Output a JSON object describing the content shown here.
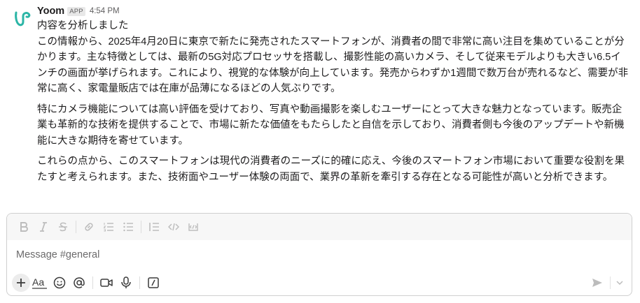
{
  "message": {
    "sender": "Yoom",
    "badge": "APP",
    "time": "4:54 PM",
    "paragraphs": [
      "内容を分析しました",
      "この情報から、2025年4月20日に東京で新たに発売されたスマートフォンが、消費者の間で非常に高い注目を集めていることが分かります。主な特徴としては、最新の5G対応プロセッサを搭載し、撮影性能の高いカメラ、そして従来モデルよりも大きい6.5インチの画面が挙げられます。これにより、視覚的な体験が向上しています。発売からわずか1週間で数万台が売れるなど、需要が非常に高く、家電量販店では在庫が品薄になるほどの人気ぶりです。",
      "特にカメラ機能については高い評価を受けており、写真や動画撮影を楽しむユーザーにとって大きな魅力となっています。販売企業も革新的な技術を提供することで、市場に新たな価値をもたらしたと自信を示しており、消費者側も今後のアップデートや新機能に大きな期待を寄せています。",
      "これらの点から、このスマートフォンは現代の消費者のニーズに的確に応え、今後のスマートフォン市場において重要な役割を果たすと考えられます。また、技術面やユーザー体験の両面で、業界の革新を牽引する存在となる可能性が高いと分析できます。"
    ]
  },
  "composer": {
    "placeholder": "Message #general"
  },
  "icons": {
    "avatar": "yoom-logo-icon",
    "bold": "bold-icon",
    "italic": "italic-icon",
    "strike": "strikethrough-icon",
    "link": "link-icon",
    "ordered_list": "ordered-list-icon",
    "bullet_list": "bullet-list-icon",
    "blockquote": "blockquote-icon",
    "code": "code-icon",
    "code_block": "code-block-icon",
    "plus": "plus-icon",
    "formatting": "formatting-icon",
    "emoji": "emoji-icon",
    "mention": "mention-icon",
    "video": "video-icon",
    "mic": "microphone-icon",
    "shortcuts": "slash-command-icon",
    "send": "send-icon",
    "send_options": "chevron-down-icon"
  },
  "colors": {
    "logo": "#2bb5a6",
    "text": "#1d1c1d",
    "muted": "#616061",
    "toolbar_bg": "#f7f7f7"
  }
}
